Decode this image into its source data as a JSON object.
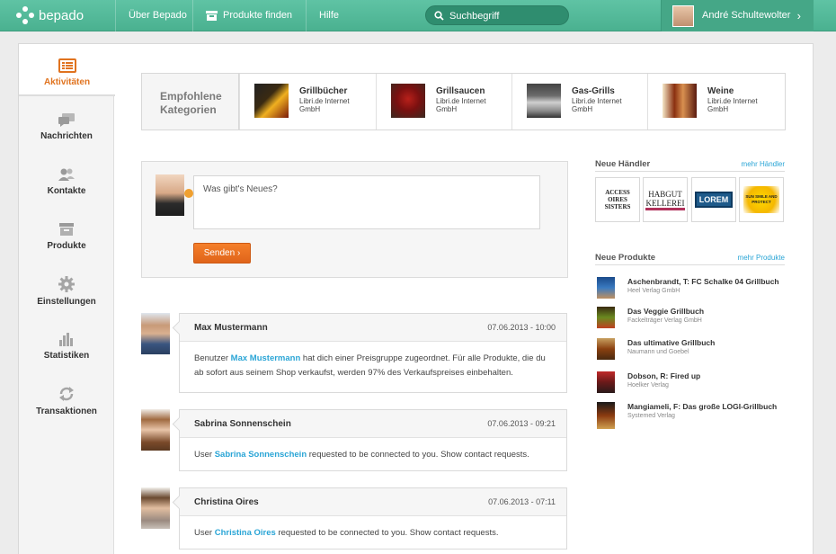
{
  "header": {
    "logo": "bepado",
    "nav": [
      "Über Bepado",
      "Produkte finden",
      "Hilfe"
    ],
    "search_placeholder": "Suchbegriff",
    "user_name": "André Schultewolter"
  },
  "sidebar": {
    "items": [
      {
        "label": "Aktivitäten",
        "icon": "activity-list-icon"
      },
      {
        "label": "Nachrichten",
        "icon": "messages-icon"
      },
      {
        "label": "Kontakte",
        "icon": "contacts-icon"
      },
      {
        "label": "Produkte",
        "icon": "products-box-icon"
      },
      {
        "label": "Einstellungen",
        "icon": "gear-icon"
      },
      {
        "label": "Statistiken",
        "icon": "bar-chart-icon"
      },
      {
        "label": "Transaktionen",
        "icon": "refresh-icon"
      }
    ]
  },
  "categories": {
    "label_line1": "Empfohlene",
    "label_line2": "Kategorien",
    "items": [
      {
        "name": "Grillbücher",
        "sub": "Libri.de Internet GmbH"
      },
      {
        "name": "Grillsaucen",
        "sub": "Libri.de Internet GmbH"
      },
      {
        "name": "Gas-Grills",
        "sub": "Libri.de Internet GmbH"
      },
      {
        "name": "Weine",
        "sub": "Libri.de Internet GmbH"
      }
    ]
  },
  "post": {
    "placeholder": "Was gibt's Neues?",
    "send_label": "Senden"
  },
  "feed": [
    {
      "name": "Max Mustermann",
      "date": "07.06.2013 - 10:00",
      "prefix": "Benutzer ",
      "link": "Max Mustermann",
      "suffix": " hat dich einer Preisgruppe zugeordnet. Für alle Produkte, die du ab sofort aus seinem Shop verkaufst, werden 97% des Verkaufspreises einbehalten."
    },
    {
      "name": "Sabrina Sonnenschein",
      "date": "07.06.2013 - 09:21",
      "prefix": "User ",
      "link": "Sabrina Sonnenschein",
      "suffix": " requested to be connected to you. Show contact requests."
    },
    {
      "name": "Christina Oires",
      "date": "07.06.2013 - 07:11",
      "prefix": "User ",
      "link": "Christina Oires",
      "suffix": " requested to be connected to you. Show contact requests."
    }
  ],
  "dealers": {
    "title": "Neue Händler",
    "more": "mehr Händler",
    "items": [
      "ACCESS OIRES SISTERS",
      "HABGUT KELLEREI",
      "LOREM",
      "SUN SMILE AND PROTECT"
    ]
  },
  "products": {
    "title": "Neue Produkte",
    "more": "mehr Produkte",
    "items": [
      {
        "title": "Aschenbrandt, T: FC Schalke 04 Grillbuch",
        "sub": "Heel Verlag GmbH"
      },
      {
        "title": "Das Veggie Grillbuch",
        "sub": "Fackelträger Verlag GmbH"
      },
      {
        "title": "Das ultimative Grillbuch",
        "sub": "Naumann und Goebel"
      },
      {
        "title": "Dobson, R: Fired up",
        "sub": "Hoelker Verlag"
      },
      {
        "title": "Mangiameli, F: Das große LOGI-Grillbuch",
        "sub": "Systemed Verlag"
      }
    ]
  },
  "colors": {
    "brand_green": "#4ab190",
    "accent_orange": "#e0731f",
    "link_blue": "#2aa5d6"
  }
}
